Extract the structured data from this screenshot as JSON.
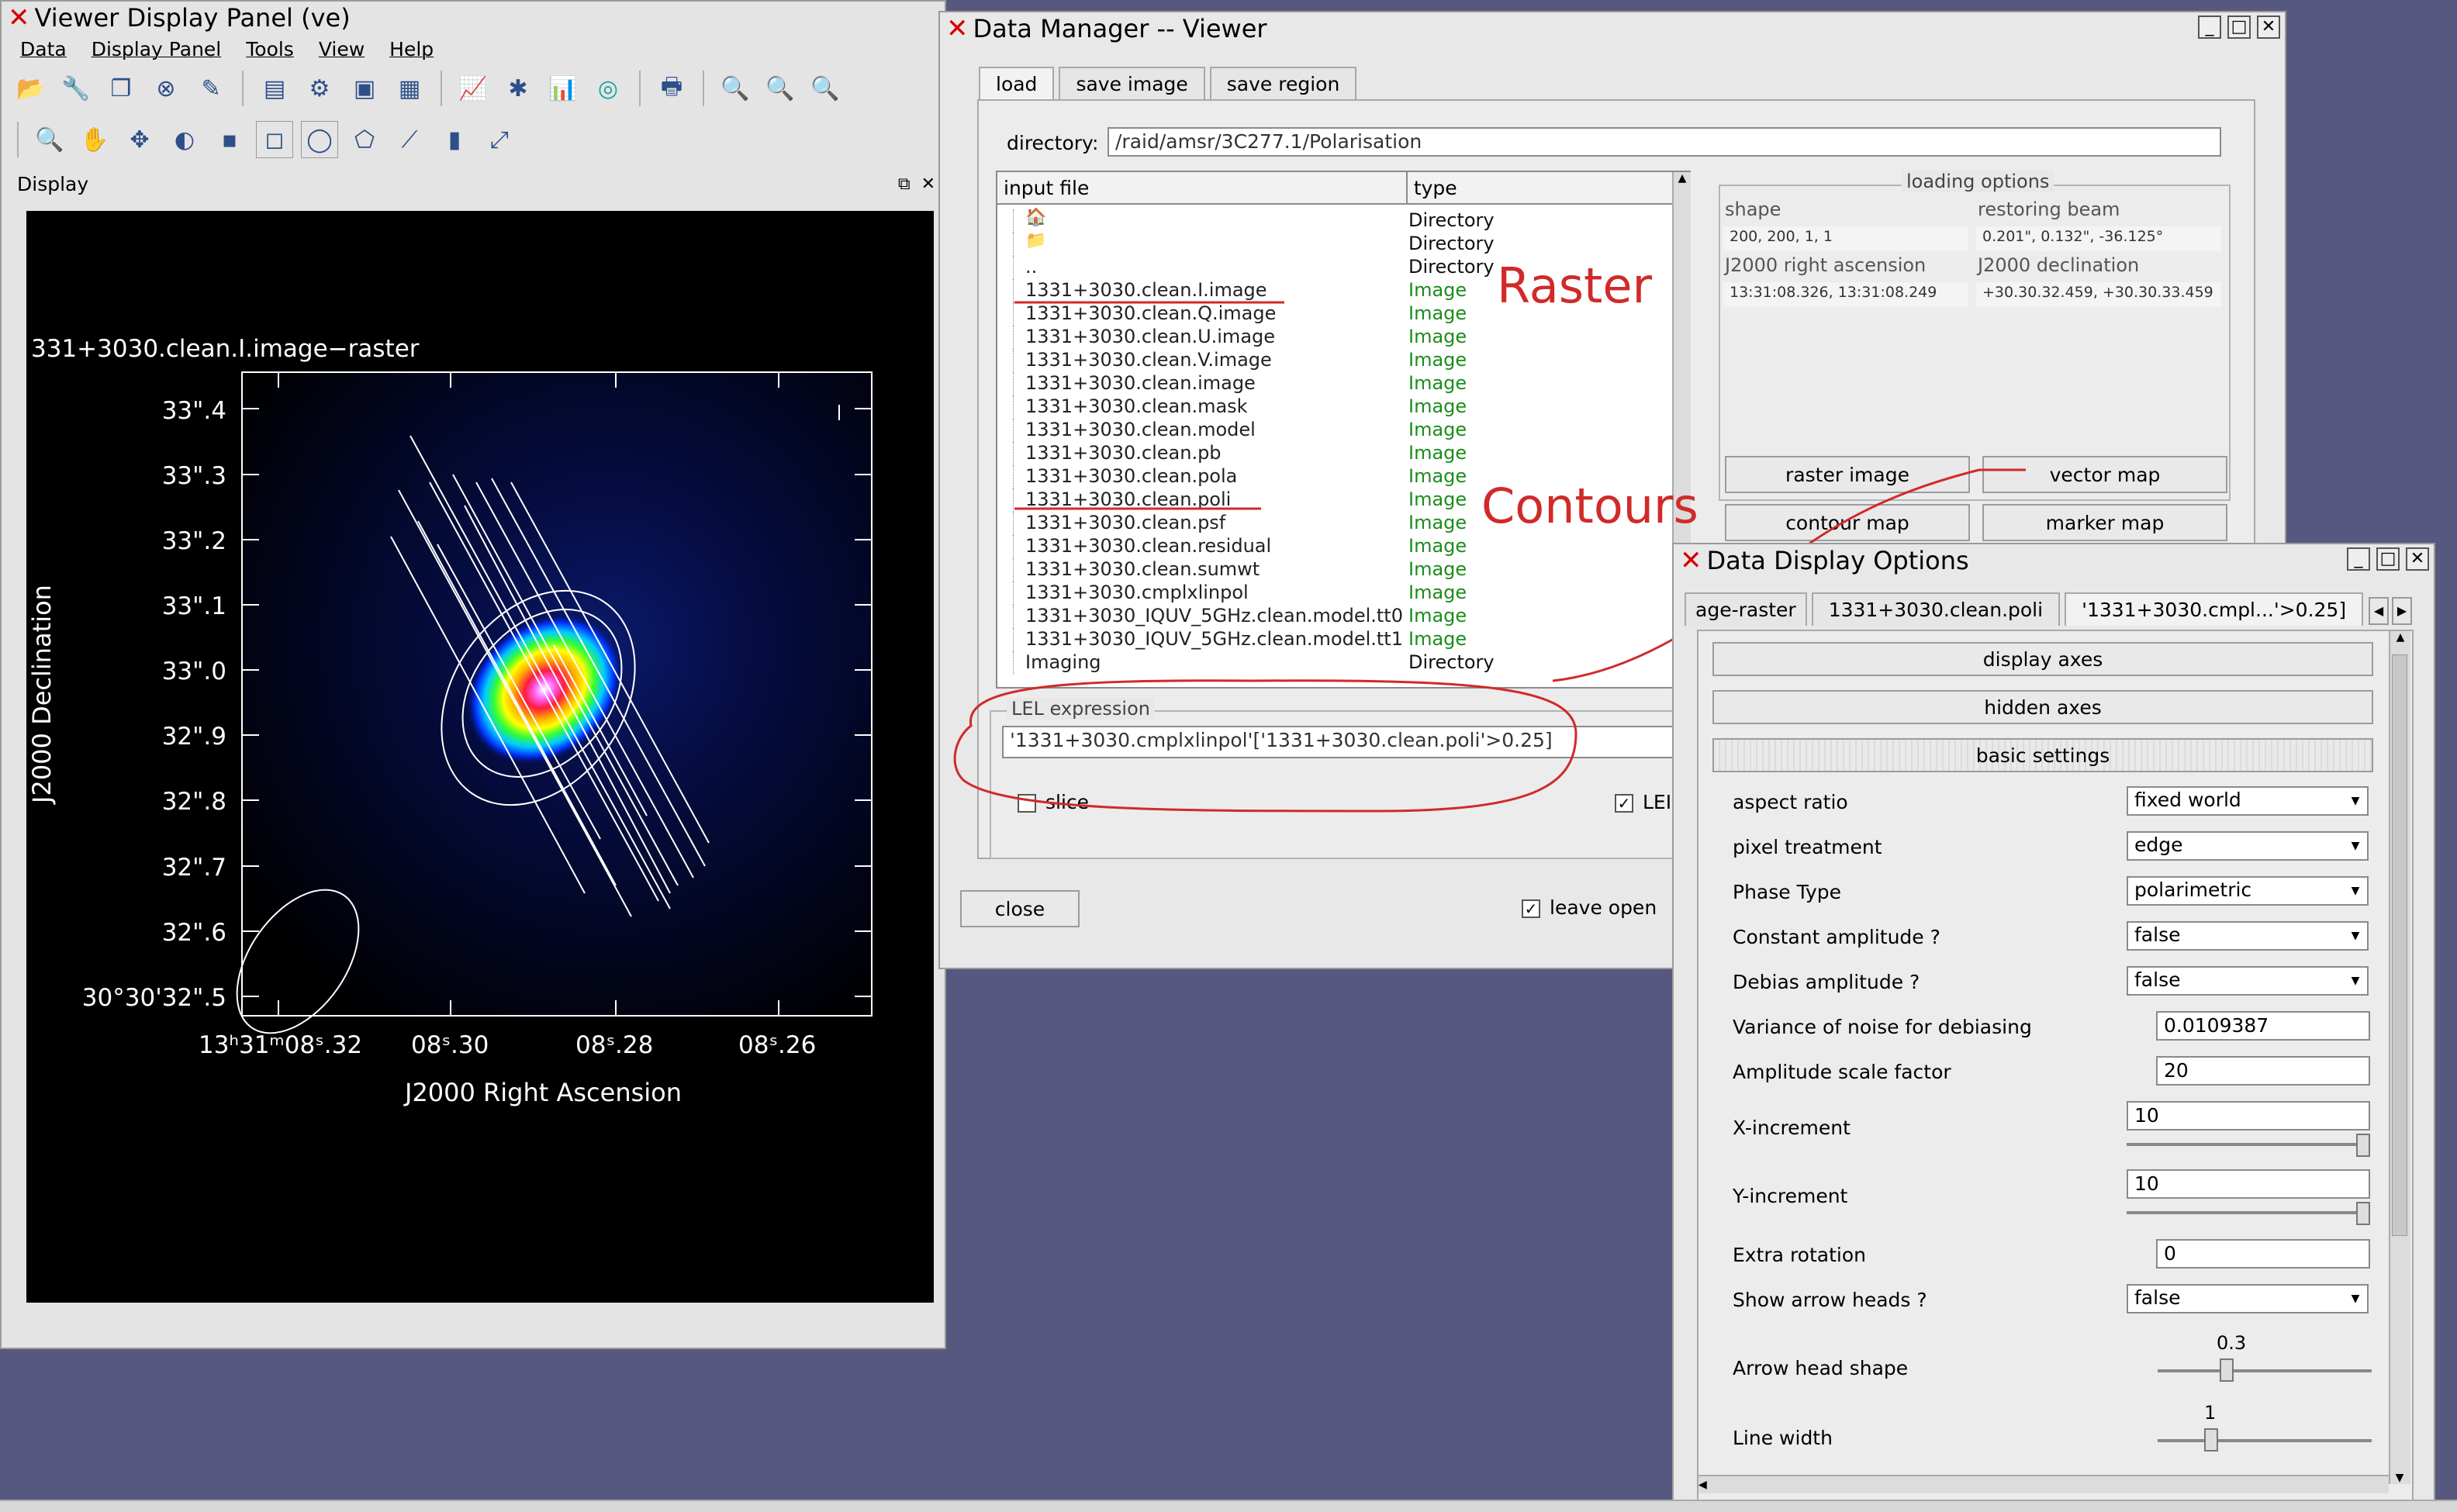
{
  "viewer": {
    "title": "Viewer Display Panel (ve)",
    "menu": [
      "Data",
      "Display Panel",
      "Tools",
      "View",
      "Help"
    ],
    "dock_label": "Display",
    "image_title": "331+3030.clean.I.image−raster",
    "y_ticks": [
      "33\".4",
      "33\".3",
      "33\".2",
      "33\".1",
      "33\".0",
      "32\".9",
      "32\".8",
      "32\".7",
      "32\".6",
      "30°30'32\".5"
    ],
    "x_ticks": [
      "13ʰ31ᵐ08ˢ.32",
      "08ˢ.30",
      "08ˢ.28",
      "08ˢ.26"
    ],
    "y_label": "J2000 Declination",
    "x_label": "J2000 Right Ascension"
  },
  "data_manager": {
    "title": "Data Manager -- Viewer",
    "tabs": [
      "load",
      "save image",
      "save region"
    ],
    "directory_label": "directory:",
    "directory_value": "/raid/amsr/3C277.1/Polarisation",
    "col_input": "input file",
    "col_type": "type",
    "files": [
      {
        "name": "",
        "type": "Directory",
        "kind": "dir"
      },
      {
        "name": "",
        "type": "Directory",
        "kind": "dir"
      },
      {
        "name": "..",
        "type": "Directory",
        "kind": "dir"
      },
      {
        "name": "1331+3030.clean.I.image",
        "type": "Image",
        "kind": "img"
      },
      {
        "name": "1331+3030.clean.Q.image",
        "type": "Image",
        "kind": "img"
      },
      {
        "name": "1331+3030.clean.U.image",
        "type": "Image",
        "kind": "img"
      },
      {
        "name": "1331+3030.clean.V.image",
        "type": "Image",
        "kind": "img"
      },
      {
        "name": "1331+3030.clean.image",
        "type": "Image",
        "kind": "img"
      },
      {
        "name": "1331+3030.clean.mask",
        "type": "Image",
        "kind": "img"
      },
      {
        "name": "1331+3030.clean.model",
        "type": "Image",
        "kind": "img"
      },
      {
        "name": "1331+3030.clean.pb",
        "type": "Image",
        "kind": "img"
      },
      {
        "name": "1331+3030.clean.pola",
        "type": "Image",
        "kind": "img"
      },
      {
        "name": "1331+3030.clean.poli",
        "type": "Image",
        "kind": "img"
      },
      {
        "name": "1331+3030.clean.psf",
        "type": "Image",
        "kind": "img"
      },
      {
        "name": "1331+3030.clean.residual",
        "type": "Image",
        "kind": "img"
      },
      {
        "name": "1331+3030.clean.sumwt",
        "type": "Image",
        "kind": "img"
      },
      {
        "name": "1331+3030.cmplxlinpol",
        "type": "Image",
        "kind": "img"
      },
      {
        "name": "1331+3030_IQUV_5GHz.clean.model.tt0",
        "type": "Image",
        "kind": "img"
      },
      {
        "name": "1331+3030_IQUV_5GHz.clean.model.tt1",
        "type": "Image",
        "kind": "img"
      },
      {
        "name": "Imaging",
        "type": "Directory",
        "kind": "dir"
      }
    ],
    "annot_raster": "Raster",
    "annot_contours": "Contours",
    "loading_options": "loading options",
    "shape_label": "shape",
    "shape_value": "200, 200, 1, 1",
    "beam_label": "restoring beam",
    "beam_value": "0.201\", 0.132\", -36.125°",
    "ra_label": "J2000 right ascension",
    "ra_value": "13:31:08.326, 13:31:08.249",
    "dec_label": "J2000 declination",
    "dec_value": "+30.30.32.459, +30.30.33.459",
    "btn_raster": "raster image",
    "btn_vector": "vector map",
    "btn_contour": "contour map",
    "btn_marker": "marker map",
    "lel_label": "LEL expression",
    "lel_value": "'1331+3030.cmplxlinpol'['1331+3030.clean.poli'>0.25]",
    "slice_label": "slice",
    "lel_short": "LEI",
    "close_label": "close",
    "leave_open_label": "leave open"
  },
  "ddo": {
    "title": "Data Display Options",
    "tabs": [
      "age-raster",
      "1331+3030.clean.poli",
      "'1331+3030.cmpl...'>0.25]"
    ],
    "sections": [
      "display axes",
      "hidden axes",
      "basic settings"
    ],
    "options": [
      {
        "label": "aspect ratio",
        "value": "fixed world",
        "kind": "combo"
      },
      {
        "label": "pixel treatment",
        "value": "edge",
        "kind": "combo"
      },
      {
        "label": "Phase Type",
        "value": "polarimetric",
        "kind": "combo"
      },
      {
        "label": "Constant amplitude ?",
        "value": "false",
        "kind": "combo"
      },
      {
        "label": "Debias amplitude ?",
        "value": "false",
        "kind": "combo"
      },
      {
        "label": "Variance of noise for debiasing",
        "value": "0.0109387",
        "kind": "text"
      },
      {
        "label": "Amplitude scale factor",
        "value": "20",
        "kind": "text"
      },
      {
        "label": "X-increment",
        "value": "10",
        "kind": "textslider"
      },
      {
        "label": "Y-increment",
        "value": "10",
        "kind": "textslider"
      },
      {
        "label": "Extra rotation",
        "value": "0",
        "kind": "text"
      },
      {
        "label": "Show arrow heads ?",
        "value": "false",
        "kind": "combo"
      },
      {
        "label": "Arrow head shape",
        "value": "0.3",
        "kind": "slider"
      },
      {
        "label": "Line width",
        "value": "1",
        "kind": "slider"
      }
    ]
  }
}
